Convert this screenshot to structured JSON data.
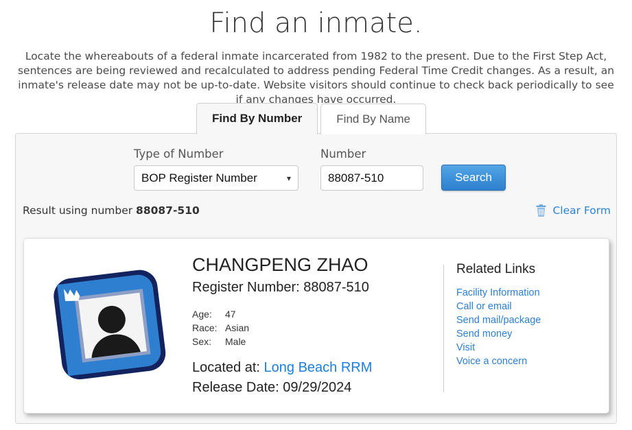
{
  "header": {
    "title": "Find an inmate.",
    "intro": "Locate the whereabouts of a federal inmate incarcerated from 1982 to the present. Due to the First Step Act, sentences are being reviewed and recalculated to address pending Federal Time Credit changes. As a result, an inmate's release date may not be up-to-date. Website visitors should continue to check back periodically to see if any changes have occurred."
  },
  "tabs": [
    {
      "label": "Find By Number",
      "active": true
    },
    {
      "label": "Find By Name",
      "active": false
    }
  ],
  "form": {
    "type_label": "Type of Number",
    "type_value": "BOP Register Number",
    "type_options": [
      "BOP Register Number"
    ],
    "chevron_icon": "chevron-down-icon",
    "number_label": "Number",
    "number_value": "88087-510",
    "number_placeholder": "",
    "search_label": "Search",
    "search_button_color": "#3d92da"
  },
  "result_meta": {
    "prefix": "Result using number",
    "number": "88087-510",
    "clear_label": "Clear Form",
    "trash_icon": "trash-icon",
    "link_color": "#2b83d4"
  },
  "result": {
    "avatar_icon": "photo-placeholder-icon",
    "name": "CHANGPENG ZHAO",
    "register_line": "Register Number: 88087-510",
    "attributes": [
      {
        "key": "Age:",
        "value": "47"
      },
      {
        "key": "Race:",
        "value": "Asian"
      },
      {
        "key": "Sex:",
        "value": "Male"
      }
    ],
    "located_label": "Located at:",
    "located_facility": "Long Beach RRM",
    "release_line": "Release Date: 09/29/2024",
    "link_color": "#1a7fe0"
  },
  "related_links": {
    "title": "Related Links",
    "items": [
      "Facility Information",
      "Call or email",
      "Send mail/package",
      "Send money",
      "Visit",
      "Voice a concern"
    ]
  }
}
